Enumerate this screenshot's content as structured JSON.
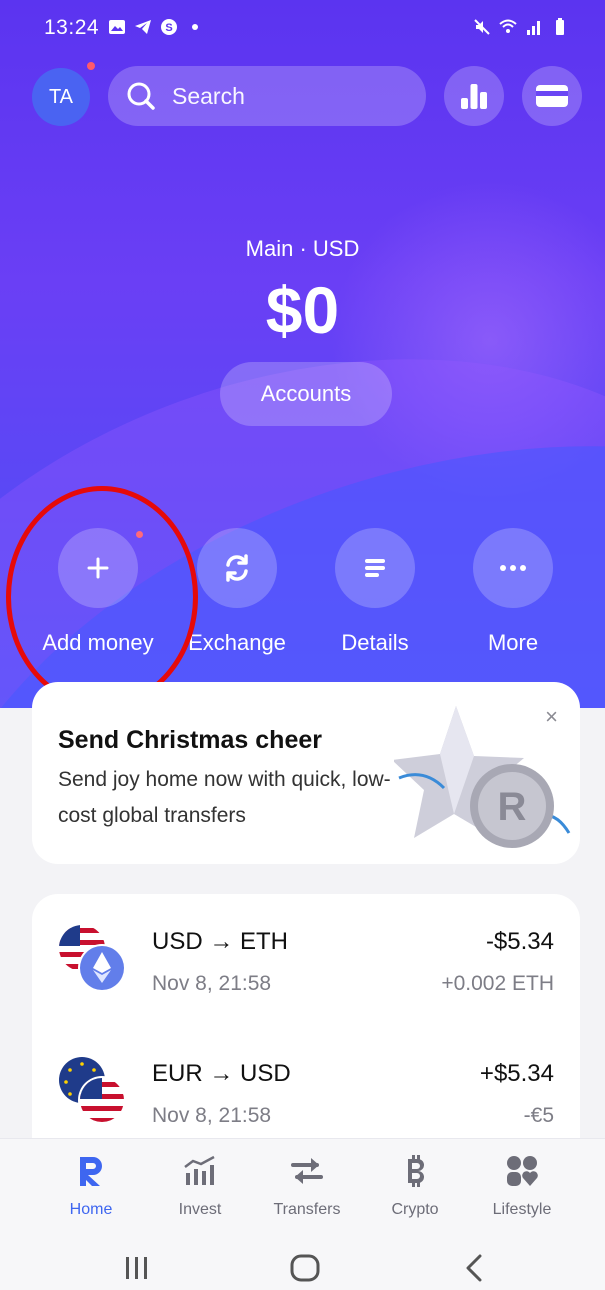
{
  "status_bar": {
    "time": "13:24",
    "left_icons": [
      "gallery-icon",
      "telegram-icon",
      "skype-icon",
      "dot-icon"
    ],
    "right_icons": [
      "mute-icon",
      "wifi-icon",
      "signal-icon",
      "battery-icon"
    ]
  },
  "header": {
    "avatar_initials": "TA",
    "search_placeholder": "Search",
    "analytics_icon": "bar-chart-icon",
    "cards_icon": "card-icon"
  },
  "balance": {
    "caption": "Main · USD",
    "amount": "$0",
    "accounts_label": "Accounts"
  },
  "actions": [
    {
      "label": "Add money",
      "icon": "plus-icon"
    },
    {
      "label": "Exchange",
      "icon": "exchange-icon"
    },
    {
      "label": "Details",
      "icon": "details-icon"
    },
    {
      "label": "More",
      "icon": "more-icon"
    }
  ],
  "promo": {
    "title": "Send Christmas cheer",
    "text": "Send joy home now with quick, low-cost global transfers",
    "close": "×"
  },
  "transactions": [
    {
      "title": "USD → ETH",
      "date": "Nov 8, 21:58",
      "amount": "-$5.34",
      "sub": "+0.002 ETH"
    },
    {
      "title": "EUR → USD",
      "date": "Nov 8, 21:58",
      "amount": "+$5.34",
      "sub": "-€5"
    }
  ],
  "bottom_nav": [
    {
      "label": "Home",
      "active": true
    },
    {
      "label": "Invest",
      "active": false
    },
    {
      "label": "Transfers",
      "active": false
    },
    {
      "label": "Crypto",
      "active": false
    },
    {
      "label": "Lifestyle",
      "active": false
    }
  ],
  "colors": {
    "hero_top": "#5b34f0",
    "hero_bottom": "#4b55f7",
    "accent": "#3e66f0",
    "highlight_circle": "#e60a0a"
  }
}
